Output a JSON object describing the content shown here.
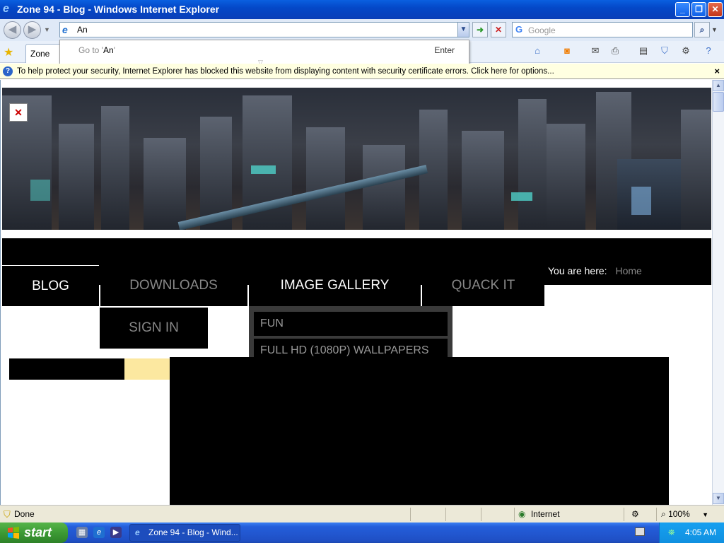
{
  "window": {
    "title": "Zone 94 - Blog - Windows Internet Explorer",
    "controls": {
      "minimize": "_",
      "maximize": "❐",
      "close": "✕"
    }
  },
  "navbar": {
    "address_value": "An",
    "go_icon": "go-arrow-icon",
    "stop_icon": "stop-icon",
    "search_placeholder": "Google",
    "search_provider_logo": "G"
  },
  "autocomplete": {
    "go_to_prefix": "Go to '",
    "go_to_value": "An",
    "go_to_suffix": "'",
    "enter_label": "Enter"
  },
  "favorites": {
    "tab_label": "Zone"
  },
  "infobar": {
    "message": "To help protect your security, Internet Explorer has blocked this website from displaying content with security certificate errors. Click here for options...",
    "close": "×"
  },
  "site": {
    "broken_image_glyph": "✕",
    "nav": {
      "blog": "BLOG",
      "downloads": "DOWNLOADS",
      "image_gallery": "IMAGE GALLERY",
      "quack_it": "QUACK IT",
      "sign_in": "SIGN IN"
    },
    "breadcrumb": {
      "label": "You are here:",
      "home": "Home"
    },
    "gallery_dropdown": [
      "FUN",
      "FULL HD (1080P) WALLPAPERS"
    ]
  },
  "statusbar": {
    "status": "Done",
    "zone": "Internet",
    "zoom": "100%"
  },
  "taskbar": {
    "start": "start",
    "task_item": "Zone 94 - Blog - Wind...",
    "clock": "4:05 AM"
  },
  "colors": {
    "titlebar": "#0a5fe0",
    "infobar": "#ffffe1",
    "nav_bg": "#000000",
    "nav_active_text": "#ffffff",
    "nav_inactive_text": "#888888",
    "sidebar_accent": "#fce8a0",
    "start_green": "#3c9a34"
  }
}
